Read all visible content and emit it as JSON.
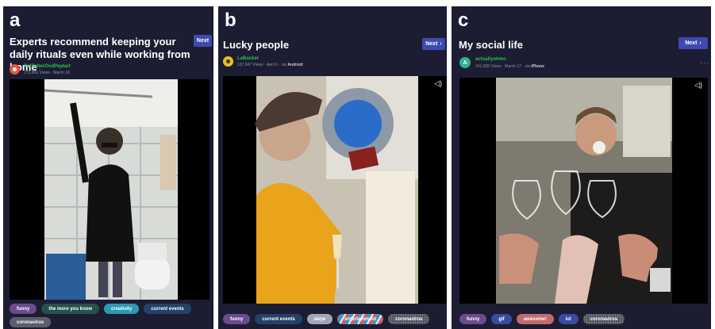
{
  "panels": [
    {
      "letter": "a",
      "title": "Experts recommend keeping your daily rituals even while working from home",
      "next_label": "Next",
      "user": "PolSalterOndPeptart",
      "views": "172,806 Views",
      "date": "March 16",
      "platform": "",
      "tags": [
        "funny",
        "the more you know",
        "creativity",
        "current events",
        "coronavirus"
      ]
    },
    {
      "letter": "b",
      "title": "Lucky people",
      "next_label": "Next",
      "user": "LaBacker",
      "views": "137,947 Views",
      "date": "April 6",
      "platform": "Android",
      "tags": [
        "funny",
        "current events",
        "awye",
        "entertainment",
        "coronavirus"
      ]
    },
    {
      "letter": "c",
      "title": "My social life",
      "next_label": "Next",
      "user": "actuallyohmo",
      "views": "101,555 Views",
      "date": "March 17",
      "platform": "iPhone",
      "avatar_letter": "A",
      "tags": [
        "funny",
        "gif",
        "awesome!",
        "lol",
        "coronavirus"
      ]
    }
  ],
  "meta_sep": "·",
  "via": "via",
  "icons": {
    "next": "chevron-right-icon",
    "speaker": "speaker-icon",
    "more": "more-dots-icon"
  },
  "colors": {
    "panel_bg": "#1c1d33",
    "next_button": "#3e4ab0",
    "username": "#2fbf4a"
  }
}
